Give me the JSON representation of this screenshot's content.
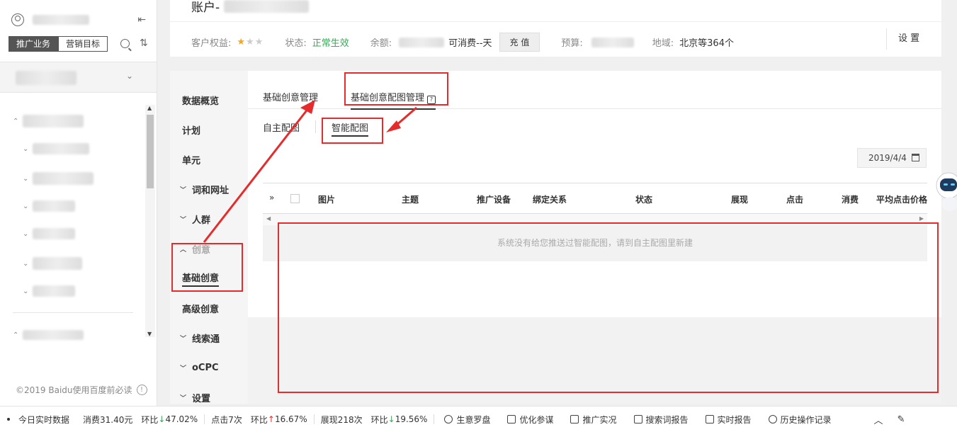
{
  "sidebar": {
    "tabs": [
      "推广业务",
      "营销目标"
    ],
    "footer": "©2019 Baidu使用百度前必读"
  },
  "account": {
    "title_prefix": "账户-",
    "rights_label": "客户权益:",
    "status_label": "状态:",
    "status_value": "正常生效",
    "balance_label": "余额:",
    "balance_suffix": "可消费--天",
    "recharge": "充 值",
    "budget_label": "预算:",
    "region_label": "地域:",
    "region_value": "北京等364个",
    "settings": "设 置",
    "stars_filled": 1,
    "stars_total": 3
  },
  "subnav": [
    {
      "label": "数据概览",
      "arrow": ""
    },
    {
      "label": "计划",
      "arrow": ""
    },
    {
      "label": "单元",
      "arrow": ""
    },
    {
      "label": "词和网址",
      "arrow": "down"
    },
    {
      "label": "人群",
      "arrow": "down"
    },
    {
      "label": "创意",
      "arrow": "up"
    },
    {
      "label": "基础创意",
      "arrow": ""
    },
    {
      "label": "高级创意",
      "arrow": ""
    },
    {
      "label": "线索通",
      "arrow": "down"
    },
    {
      "label": "oCPC",
      "arrow": "down"
    },
    {
      "label": "设置",
      "arrow": "down"
    }
  ],
  "tabs": {
    "main": [
      "基础创意管理",
      "基础创意配图管理"
    ],
    "sub": [
      "自主配图",
      "智能配图"
    ],
    "date": "2019/4/4"
  },
  "table": {
    "columns": [
      "图片",
      "主题",
      "推广设备",
      "绑定关系",
      "状态",
      "展现",
      "点击",
      "消费",
      "平均点击价格"
    ],
    "empty": "系统没有给您推送过智能配图，请到自主配图里新建"
  },
  "statusbar": {
    "realtime": "今日实时数据",
    "spend": "消费31.40元",
    "spend_ratio_label": "环比",
    "spend_ratio": "47.02%",
    "clicks": "点击7次",
    "clicks_ratio_label": "环比",
    "clicks_ratio": "16.67%",
    "impressions": "展现218次",
    "imp_ratio_label": "环比",
    "imp_ratio": "19.56%",
    "tools": [
      "生意罗盘",
      "优化参谋",
      "推广实况",
      "搜索词报告",
      "实时报告",
      "历史操作记录"
    ]
  },
  "colors": {
    "annotation": "#e52b2b",
    "status_green": "#3aa757",
    "star": "#f5a623"
  }
}
